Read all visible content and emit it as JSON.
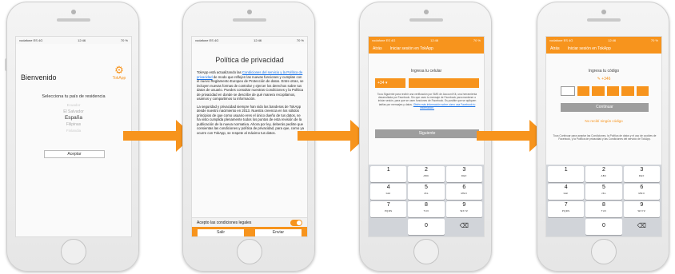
{
  "colors": {
    "accent": "#f7941d",
    "gray_button": "#9e9e9e",
    "link": "#1a73e8"
  },
  "statusbar": {
    "carrier": "vodafone ES 4G",
    "time": "12:46",
    "battery": "70 %"
  },
  "screen1": {
    "title": "Bienvenido",
    "brand": "TokApp",
    "subtitle": "Selecciona tu país de residencia",
    "countries": [
      "Ecuador",
      "El Salvador",
      "España",
      "Filipinas",
      "Finlandia"
    ],
    "accept_button": "Aceptar"
  },
  "screen2": {
    "title": "Política de privacidad",
    "body_intro": "TokApp está actualizando las",
    "body_link": "Condiciones del servicio y la Política de privacidad",
    "body_rest": "de modo que reflejen las nuevas funciones y cumplan con el nuevo Reglamento Europeo de Protección de datos. Entre otras, se incluyen nuevas formas de controlar y ejercer los derechos sobre tus datos de usuario. Puedes consultar nuestras Condiciones y la Política de privacidad en donde se describe de qué manera recopilamos, usamos y compartimos tu información.",
    "body_p2": "La seguridad y privacidad siempre han sido las banderas de TokApp desde nuestro nacimiento en 2013. Nuestra creencia en los sólidos principios de que como usuario eres el único dueño de tus datos, se ha visto cumplida plenamente todos los puntos de esta revisión de la publicación de la nueva normativa. Ahora por ley, deberás pedirte que consientas las condiciones y política de privacidad, para que, como ya ocurre con TokApp, se respete al máximo tus datos.",
    "accept_conditions": "Acepto las condiciones legales",
    "exit_button": "Salir",
    "send_button": "Enviar"
  },
  "screen3": {
    "back": "Atrás",
    "nav_title": "Iniciar sesión en TokApp",
    "label": "Ingresa tu celular",
    "country_code": "+34 ▾",
    "legal": "Toca Siguiente para recibir una verificación por SMS de Account Kit, una herramienta desarrollada por Facebook. Sin que uses tu mensaje de Facebook para mantener o iniciar sesión, para que se usen funciones de Facebook. Es posible que se apliquen tarifas por mensajes y datos.",
    "legal_link": "Obtén más información sobre cómo usa Facebook tu información.",
    "next_button": "Siguiente"
  },
  "screen4": {
    "back": "Atrás",
    "nav_title": "Iniciar sesión en TokApp",
    "label": "Ingresa tu código",
    "phone": "✎ +346",
    "continue_button": "Continuar",
    "resend": "No recibí ningún código",
    "legal": "Toca Continuar para aceptar las Condiciones, la Política de datos y el uso de cookies de Facebook, y la Política de privacidad y las Condiciones del servicio de TokApp."
  },
  "keypad": [
    {
      "d": "1",
      "l": ""
    },
    {
      "d": "2",
      "l": "ABC"
    },
    {
      "d": "3",
      "l": "DEF"
    },
    {
      "d": "4",
      "l": "GHI"
    },
    {
      "d": "5",
      "l": "JKL"
    },
    {
      "d": "6",
      "l": "MNO"
    },
    {
      "d": "7",
      "l": "PQRS"
    },
    {
      "d": "8",
      "l": "TUV"
    },
    {
      "d": "9",
      "l": "WXYZ"
    },
    {
      "d": "0",
      "l": ""
    }
  ]
}
